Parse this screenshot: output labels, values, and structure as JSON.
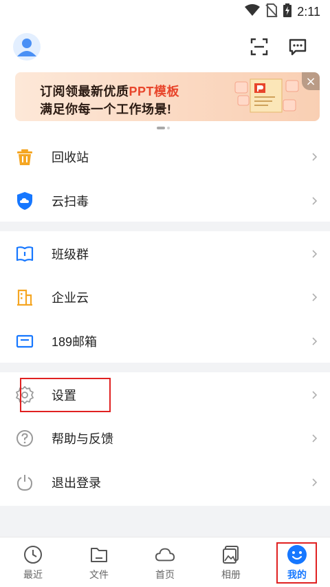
{
  "status_bar": {
    "time": "2:11"
  },
  "banner": {
    "line1_prefix": "订阅领最新优质",
    "line1_highlight": "PPT模板",
    "line2": "满足你每一个工作场景!",
    "close_label": "×"
  },
  "menu": {
    "group1": [
      {
        "label": "回收站",
        "icon": "trash-icon",
        "color": "#f5a623"
      },
      {
        "label": "云扫毒",
        "icon": "shield-icon",
        "color": "#1677ff"
      }
    ],
    "group2": [
      {
        "label": "班级群",
        "icon": "class-book-icon",
        "color": "#1677ff"
      },
      {
        "label": "企业云",
        "icon": "building-icon",
        "color": "#f5a623"
      },
      {
        "label": "189邮箱",
        "icon": "mail-icon",
        "color": "#1677ff"
      }
    ],
    "group3": [
      {
        "label": "设置",
        "icon": "gear-icon",
        "color": "#999999"
      },
      {
        "label": "帮助与反馈",
        "icon": "help-icon",
        "color": "#999999"
      },
      {
        "label": "退出登录",
        "icon": "power-icon",
        "color": "#999999"
      }
    ]
  },
  "tabs": [
    {
      "label": "最近",
      "icon": "clock-icon",
      "active": false
    },
    {
      "label": "文件",
      "icon": "folder-icon",
      "active": false
    },
    {
      "label": "首页",
      "icon": "cloud-icon",
      "active": false
    },
    {
      "label": "相册",
      "icon": "album-icon",
      "active": false
    },
    {
      "label": "我的",
      "icon": "smiley-icon",
      "active": true
    }
  ],
  "colors": {
    "accent": "#1677ff",
    "highlight_box": "#e02020",
    "band": "#f2f3f5"
  }
}
